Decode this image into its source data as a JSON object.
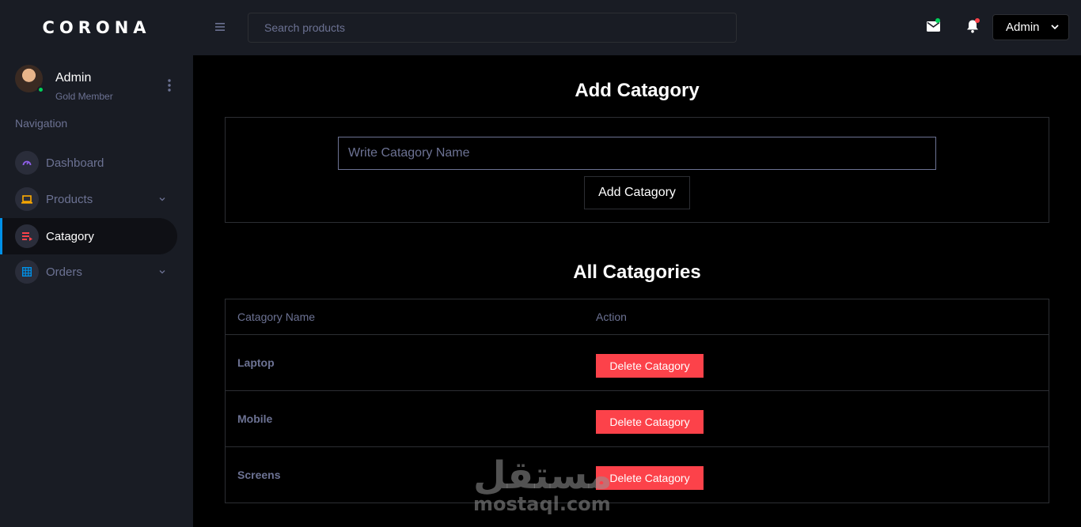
{
  "brand": "CORONA",
  "search": {
    "placeholder": "Search products"
  },
  "header": {
    "admin_label": "Admin",
    "mail_dot_color": "#00d25b",
    "bell_dot_color": "#fc424a"
  },
  "sidebar": {
    "profile": {
      "name": "Admin",
      "role": "Gold Member"
    },
    "heading": "Navigation",
    "items": [
      {
        "label": "Dashboard",
        "icon": "speedometer-icon",
        "icon_color": "#8f5fe8",
        "active": false,
        "has_children": false
      },
      {
        "label": "Products",
        "icon": "laptop-icon",
        "icon_color": "#ffab00",
        "active": false,
        "has_children": true
      },
      {
        "label": "Catagory",
        "icon": "playlist-icon",
        "icon_color": "#fc424a",
        "active": true,
        "has_children": false
      },
      {
        "label": "Orders",
        "icon": "table-icon",
        "icon_color": "#0090e7",
        "active": false,
        "has_children": true
      }
    ]
  },
  "main": {
    "add_title": "Add Catagory",
    "input_placeholder": "Write Catagory Name",
    "add_button": "Add Catagory",
    "list_title": "All Catagories",
    "table": {
      "headers": [
        "Catagory Name",
        "Action"
      ],
      "rows": [
        {
          "name": "Laptop",
          "action": "Delete Catagory"
        },
        {
          "name": "Mobile",
          "action": "Delete Catagory"
        },
        {
          "name": "Screens",
          "action": "Delete Catagory"
        }
      ]
    }
  },
  "watermark": {
    "arabic": "مستقل",
    "latin": "mostaql.com"
  }
}
